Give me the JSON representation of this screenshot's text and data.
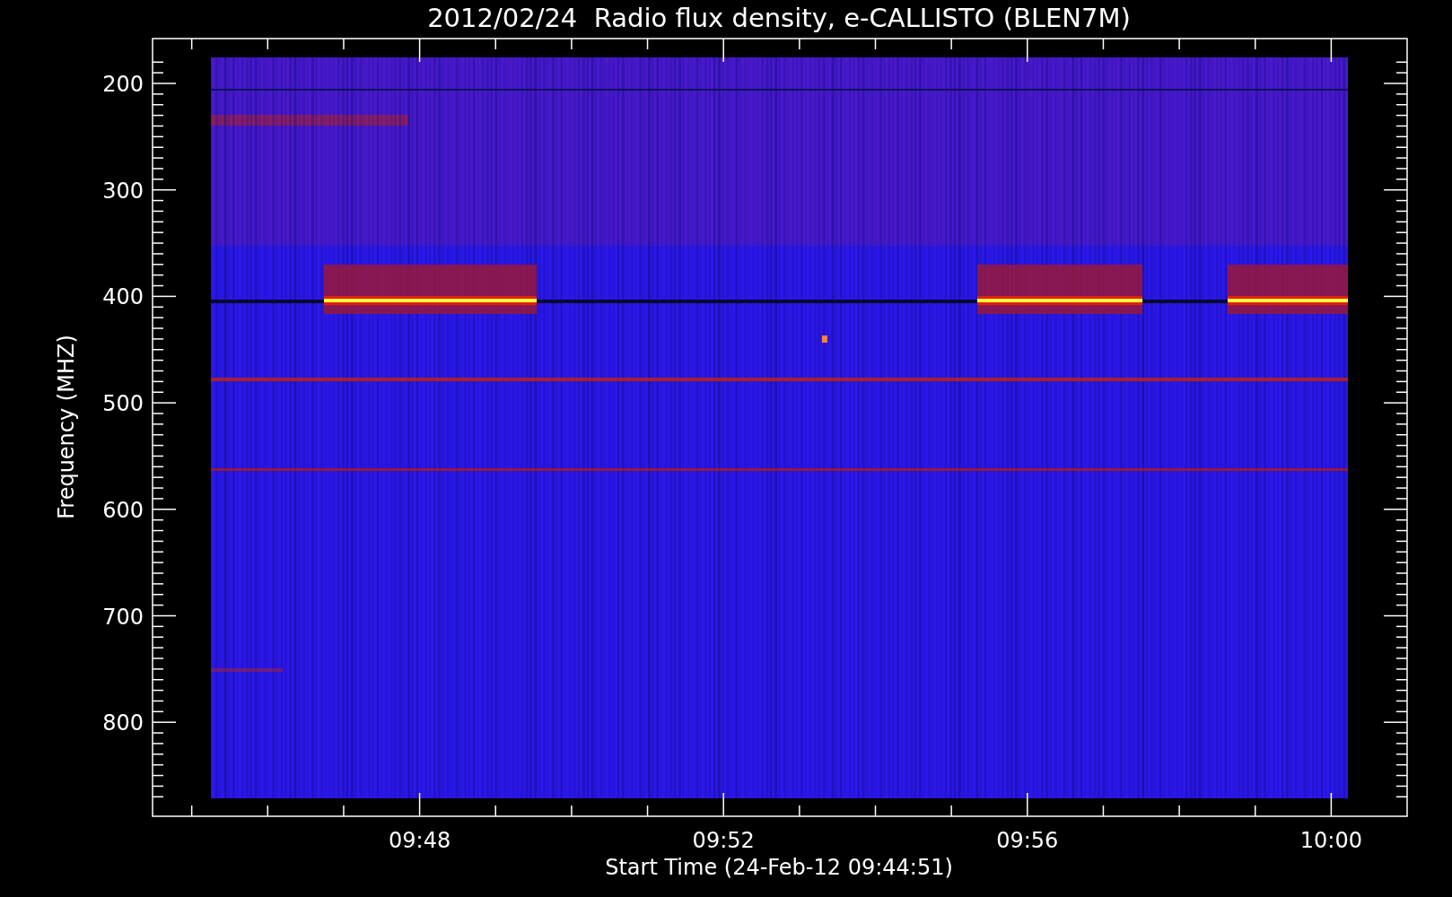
{
  "title": "2012/02/24  Radio flux density, e-CALLISTO (BLEN7M)",
  "y_axis": {
    "label": "Frequency (MHZ)",
    "ticks": [
      "200",
      "300",
      "400",
      "500",
      "600",
      "700",
      "800"
    ]
  },
  "x_axis": {
    "label": "Start Time (24-Feb-12 09:44:51)",
    "ticks": [
      "09:48",
      "09:52",
      "09:56",
      "10:00"
    ]
  }
}
